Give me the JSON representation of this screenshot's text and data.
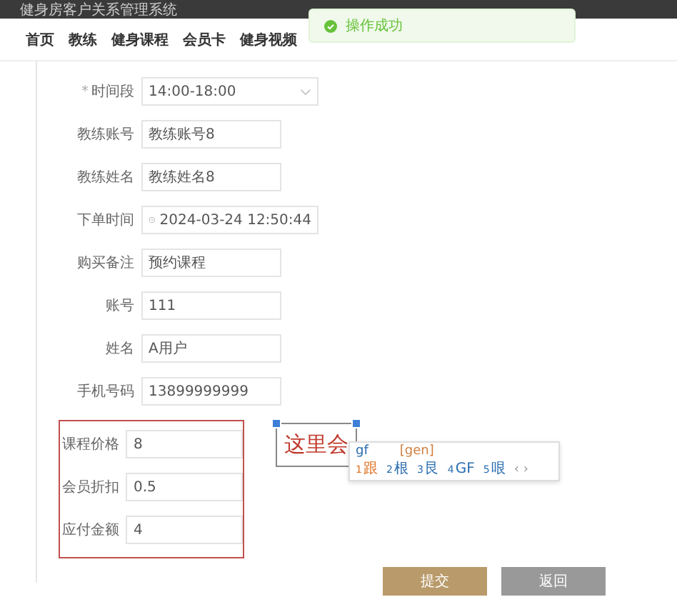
{
  "header": {
    "title": "健身房客户关系管理系统"
  },
  "nav": [
    {
      "label": "首页"
    },
    {
      "label": "教练"
    },
    {
      "label": "健身课程"
    },
    {
      "label": "会员卡"
    },
    {
      "label": "健身视频"
    }
  ],
  "toast": {
    "kind": "success",
    "text": "操作成功"
  },
  "form": {
    "required_mark": "*",
    "fields": [
      {
        "label": "时间段",
        "value": "14:00-18:00",
        "kind": "select",
        "required": true,
        "highlighted": false
      },
      {
        "label": "教练账号",
        "value": "教练账号8",
        "kind": "text",
        "required": false,
        "highlighted": false
      },
      {
        "label": "教练姓名",
        "value": "教练姓名8",
        "kind": "text",
        "required": false,
        "highlighted": false
      },
      {
        "label": "下单时间",
        "value": "2024-03-24 12:50:44",
        "kind": "datetime",
        "required": false,
        "highlighted": false
      },
      {
        "label": "购买备注",
        "value": "预约课程",
        "kind": "text",
        "required": false,
        "highlighted": false
      },
      {
        "label": "账号",
        "value": "111",
        "kind": "text",
        "required": false,
        "highlighted": false
      },
      {
        "label": "姓名",
        "value": "A用户",
        "kind": "text",
        "required": false,
        "highlighted": false
      },
      {
        "label": "手机号码",
        "value": "13899999999",
        "kind": "text",
        "required": false,
        "highlighted": false
      },
      {
        "label": "课程价格",
        "value": "8",
        "kind": "text",
        "required": false,
        "highlighted": true
      },
      {
        "label": "会员折扣",
        "value": "0.5",
        "kind": "text",
        "required": false,
        "highlighted": true
      },
      {
        "label": "应付金额",
        "value": "4",
        "kind": "text",
        "required": false,
        "highlighted": true
      }
    ],
    "buttons": [
      {
        "label": "提交",
        "kind": "primary"
      },
      {
        "label": "返回",
        "kind": "secondary"
      }
    ]
  },
  "annotation": {
    "text": "这里会"
  },
  "ime": {
    "input": "gf",
    "pinyin": "[gen]",
    "candidates": [
      {
        "index": "1",
        "text": "跟",
        "selected": true
      },
      {
        "index": "2",
        "text": "根",
        "selected": false
      },
      {
        "index": "3",
        "text": "艮",
        "selected": false
      },
      {
        "index": "4",
        "text": "GF",
        "selected": false
      },
      {
        "index": "5",
        "text": "哏",
        "selected": false
      }
    ],
    "pager": "‹ ›"
  }
}
